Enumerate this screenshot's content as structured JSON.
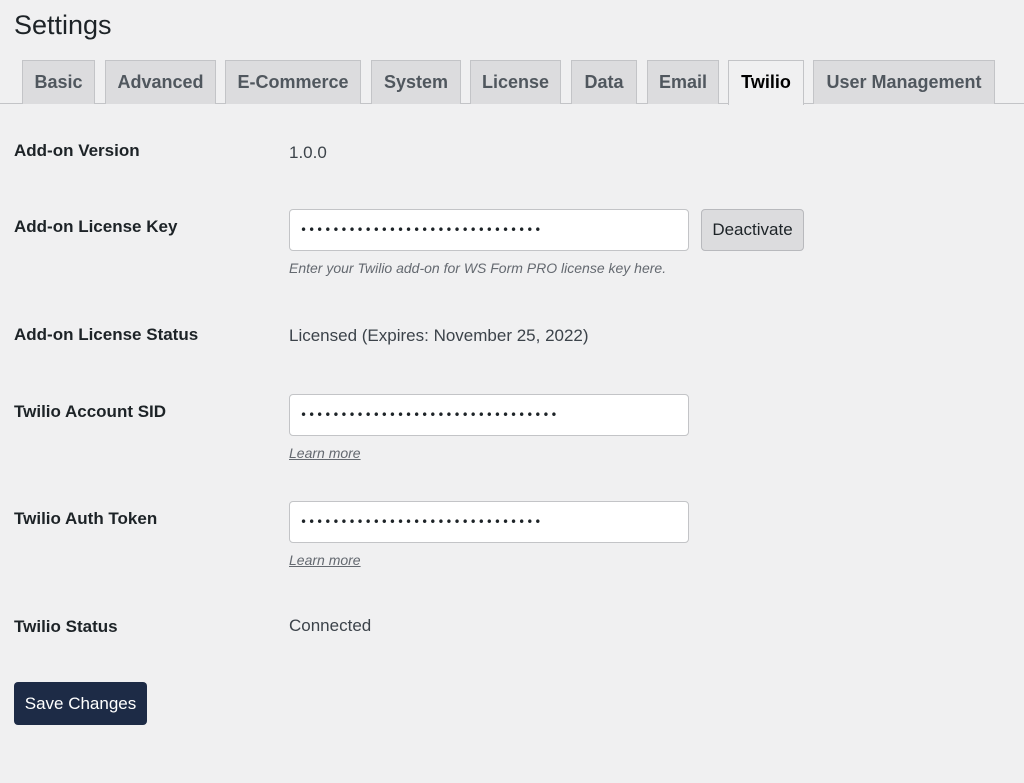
{
  "page": {
    "title": "Settings"
  },
  "tabs": [
    {
      "label": "Basic",
      "active": false
    },
    {
      "label": "Advanced",
      "active": false
    },
    {
      "label": "E-Commerce",
      "active": false
    },
    {
      "label": "System",
      "active": false
    },
    {
      "label": "License",
      "active": false
    },
    {
      "label": "Data",
      "active": false
    },
    {
      "label": "Email",
      "active": false
    },
    {
      "label": "Twilio",
      "active": true
    },
    {
      "label": "User Management",
      "active": false
    }
  ],
  "settings": {
    "addon_version": {
      "label": "Add-on Version",
      "value": "1.0.0"
    },
    "license_key": {
      "label": "Add-on License Key",
      "value": "••••••••••••••••••••••••••••••",
      "button": "Deactivate",
      "description": "Enter your Twilio add-on for WS Form PRO license key here."
    },
    "license_status": {
      "label": "Add-on License Status",
      "value": "Licensed (Expires: November 25, 2022)"
    },
    "account_sid": {
      "label": "Twilio Account SID",
      "value": "••••••••••••••••••••••••••••••••",
      "link": "Learn more"
    },
    "auth_token": {
      "label": "Twilio Auth Token",
      "value": "••••••••••••••••••••••••••••••",
      "link": "Learn more"
    },
    "twilio_status": {
      "label": "Twilio Status",
      "value": "Connected"
    }
  },
  "actions": {
    "save_label": "Save Changes"
  },
  "colors": {
    "background": "#f0f0f1",
    "primary_button": "#1d2b46",
    "tab_inactive": "#dcdcde",
    "text": "#1d2327"
  }
}
